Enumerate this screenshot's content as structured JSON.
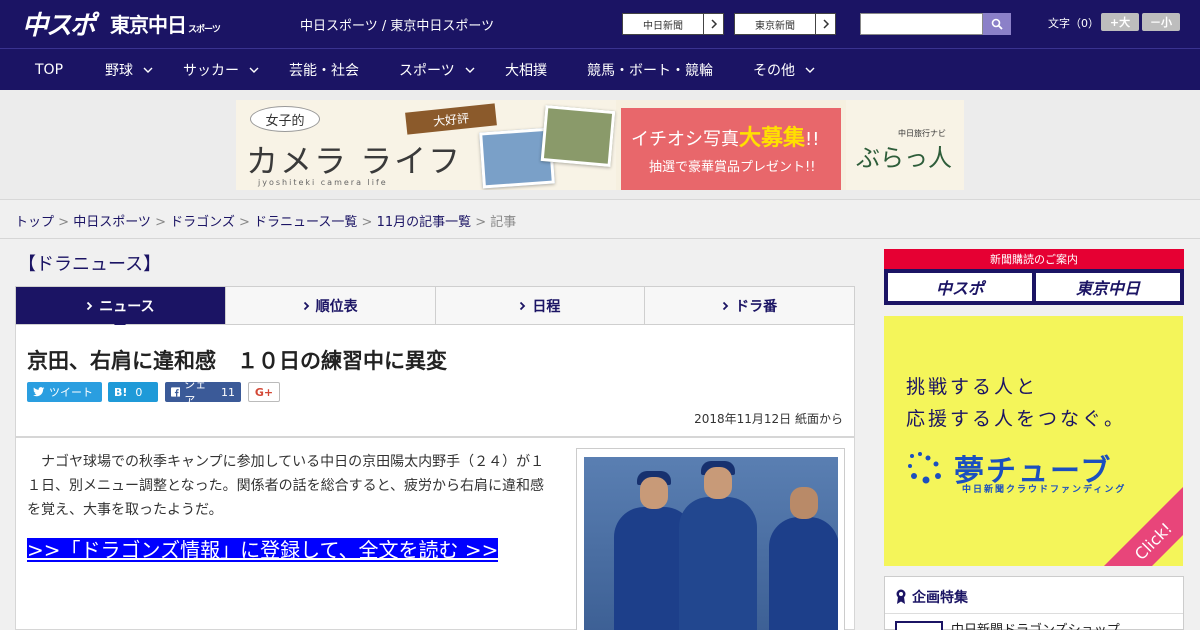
{
  "header": {
    "logo_chuspo": "中スポ",
    "logo_tokyo": "東京中日",
    "logo_tokyo_small": "スポーツ",
    "site_links": "中日スポーツ / 東京中日スポーツ",
    "buttons": [
      {
        "label": "中日新聞"
      },
      {
        "label": "東京新聞"
      }
    ],
    "search_placeholder": "",
    "font_size_label": "文字（0）",
    "font_plus": "+大",
    "font_minus": "－小"
  },
  "nav": {
    "items": [
      {
        "label": "TOP",
        "has_dropdown": false
      },
      {
        "label": "野球",
        "has_dropdown": true
      },
      {
        "label": "サッカー",
        "has_dropdown": true
      },
      {
        "label": "芸能・社会",
        "has_dropdown": false
      },
      {
        "label": "スポーツ",
        "has_dropdown": true
      },
      {
        "label": "大相撲",
        "has_dropdown": false
      },
      {
        "label": "競馬・ボート・競輪",
        "has_dropdown": false
      },
      {
        "label": "その他",
        "has_dropdown": true
      }
    ]
  },
  "banner": {
    "joshi": "女子的",
    "camera": "カメラ ライフ",
    "sub": "jyoshiteki camera life",
    "tag": "大好評",
    "headline_pre": "イチオシ写真",
    "headline_big": "大募集",
    "headline_post": "!!",
    "prize": "抽選で豪華賞品プレゼント!!",
    "brand_sub": "中日旅行ナビ",
    "brand": "ぶらっ人"
  },
  "breadcrumb": {
    "items": [
      "トップ",
      "中日スポーツ",
      "ドラゴンズ",
      "ドラニュース一覧",
      "11月の記事一覧"
    ],
    "sep": " > ",
    "current": "記事"
  },
  "section_title": "【ドラニュース】",
  "tabs": [
    {
      "label": "ニュース",
      "active": true
    },
    {
      "label": "順位表",
      "active": false
    },
    {
      "label": "日程",
      "active": false
    },
    {
      "label": "ドラ番",
      "active": false
    }
  ],
  "article": {
    "headline": "京田、右肩に違和感　１０日の練習中に異変",
    "share": {
      "tweet": "ツイート",
      "hatena_count": "0",
      "facebook": "シェア",
      "facebook_count": "11",
      "gplus": "G+"
    },
    "date": "2018年11月12日 紙面から",
    "lead": "ナゴヤ球場での秋季キャンプに参加している中日の京田陽太内野手（２４）が１１日、別メニュー調整となった。関係者の話を総合すると、疲労から右肩に違和感を覚え、大事を取ったようだ。",
    "cta": ">>「ドラゴンズ情報」に登録して、全文を読む >>"
  },
  "sidebar": {
    "subscribe_header": "新聞購読のご案内",
    "subscribe_chuspo": "中スポ",
    "subscribe_tokyo": "東京中日",
    "yume_line1": "挑戦する人と",
    "yume_line2": "応援する人をつなぐ。",
    "yume_logo": "夢チューブ",
    "yume_caption": "中日新聞クラウドファンディング",
    "yume_click": "Click!",
    "plan_title": "企画特集",
    "plan_item": "中日新聞ドラゴンズショップ"
  },
  "colors": {
    "brand_navy": "#1b1464",
    "cta_blue": "#0000ff",
    "sub_red": "#e60033",
    "yume_yellow": "#f4f55a"
  }
}
